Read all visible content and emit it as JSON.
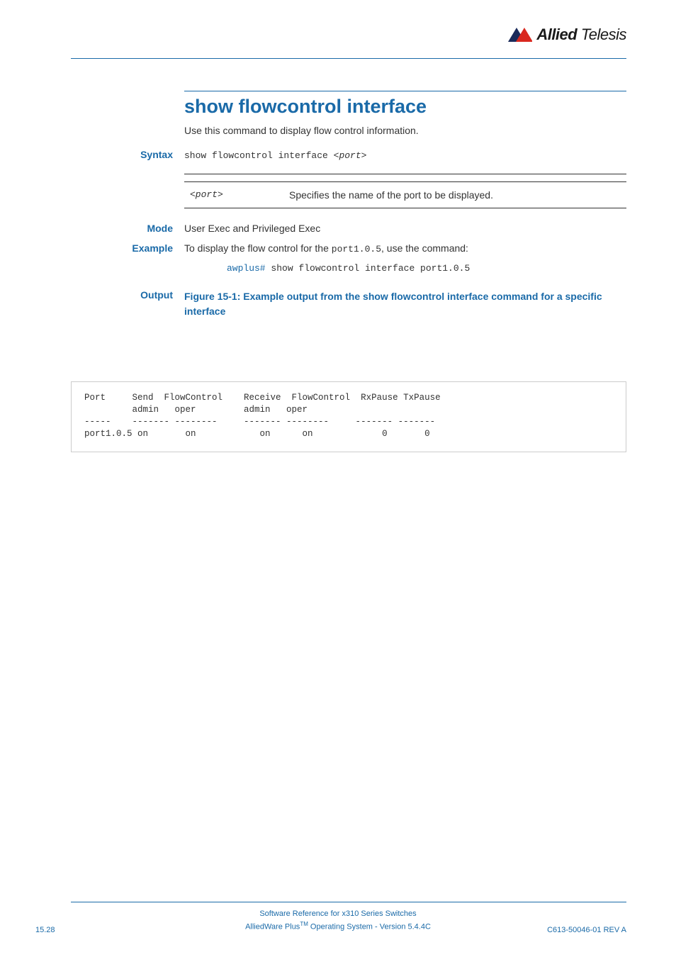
{
  "logo": {
    "brand_strong": "Allied",
    "brand_light": " Telesis"
  },
  "title": "show flowcontrol interface",
  "intro": "Use this command to display flow control information.",
  "syntax": {
    "label": "Syntax",
    "cmd_prefix": "show flowcontrol interface ",
    "cmd_param": "<port>"
  },
  "param": {
    "name": "<port>",
    "desc": "Specifies the name of the port to be displayed."
  },
  "mode": {
    "label": "Mode",
    "text": "User Exec and Privileged Exec"
  },
  "example": {
    "label": "Example",
    "text_before": "To display the flow control for the ",
    "code_inline": "port1.0.5",
    "text_after": ", use the command:",
    "prompt": "awplus#",
    "cmd": " show flowcontrol interface port1.0.5"
  },
  "output": {
    "label": "Output",
    "caption": "Figure 15-1: Example output from the show flowcontrol interface command for a specific interface"
  },
  "figure_text": "Port     Send  FlowControl    Receive  FlowControl  RxPause TxPause\n         admin   oper         admin   oper\n-----    ------- --------     ------- --------     ------- -------\nport1.0.5 on       on            on      on             0       0",
  "chart_data": {
    "type": "table",
    "title": "Example output from the show flowcontrol interface command for a specific interface",
    "columns": [
      "Port",
      "Send admin",
      "FlowControl oper",
      "Receive admin",
      "FlowControl oper",
      "RxPause",
      "TxPause"
    ],
    "rows": [
      {
        "Port": "port1.0.5",
        "Send admin": "on",
        "FlowControl oper (send)": "on",
        "Receive admin": "on",
        "FlowControl oper (receive)": "on",
        "RxPause": 0,
        "TxPause": 0
      }
    ]
  },
  "footer": {
    "line1": "Software Reference for x310 Series Switches",
    "line2_pre": "AlliedWare Plus",
    "line2_tm": "TM",
    "line2_post": " Operating System  - Version 5.4.4C",
    "page_left": "15.28",
    "page_right": "C613-50046-01 REV A"
  }
}
